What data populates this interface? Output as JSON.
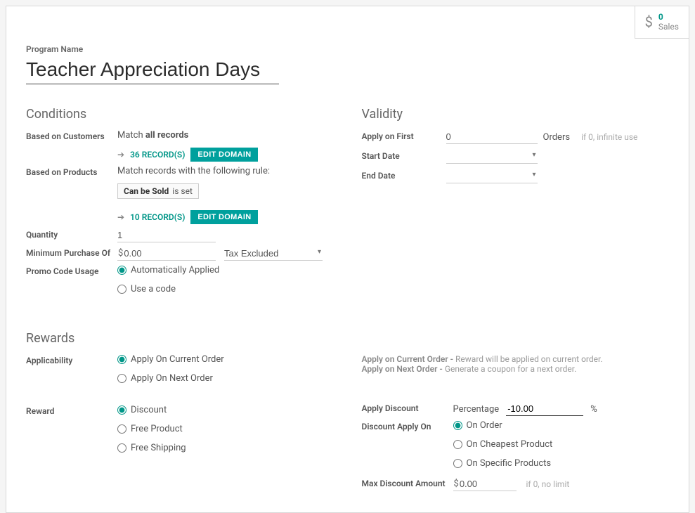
{
  "stats": {
    "count": "0",
    "label": "Sales"
  },
  "program": {
    "label": "Program Name",
    "value": "Teacher Appreciation Days"
  },
  "conditions": {
    "header": "Conditions",
    "based_customers_label": "Based on Customers",
    "customers_match_prefix": "Match ",
    "customers_match_bold": "all records",
    "customers_records": "36 RECORD(S)",
    "edit_domain": "EDIT DOMAIN",
    "based_products_label": "Based on Products",
    "products_match_text": "Match records with the following rule:",
    "rule_field": "Can be Sold",
    "rule_op": "is set",
    "products_records": "10 RECORD(S)",
    "quantity_label": "Quantity",
    "quantity_value": "1",
    "min_purchase_label": "Minimum Purchase Of",
    "min_purchase_value": "0.00",
    "tax_label": "Tax Excluded",
    "promo_label": "Promo Code Usage",
    "promo_auto": "Automatically Applied",
    "promo_code": "Use a code"
  },
  "validity": {
    "header": "Validity",
    "apply_first_label": "Apply on First",
    "apply_first_value": "0",
    "apply_first_suffix": "Orders",
    "apply_first_hint": "if 0, infinite use",
    "start_label": "Start Date",
    "end_label": "End Date"
  },
  "rewards": {
    "header": "Rewards",
    "applicability_label": "Applicability",
    "apply_current": "Apply On Current Order",
    "apply_next": "Apply On Next Order",
    "hint_current_b": "Apply on Current Order - ",
    "hint_current": "Reward will be applied on current order.",
    "hint_next_b": "Apply on Next Order - ",
    "hint_next": "Generate a coupon for a next order.",
    "reward_label": "Reward",
    "reward_discount": "Discount",
    "reward_free_product": "Free Product",
    "reward_free_ship": "Free Shipping",
    "apply_discount_label": "Apply Discount",
    "percentage": "Percentage",
    "percent_value": "-10.00",
    "percent_sym": "%",
    "disc_apply_on_label": "Discount Apply On",
    "on_order": "On Order",
    "on_cheapest": "On Cheapest Product",
    "on_specific": "On Specific Products",
    "max_disc_label": "Max Discount Amount",
    "max_disc_value": "0.00",
    "max_disc_hint": "if 0, no limit"
  }
}
